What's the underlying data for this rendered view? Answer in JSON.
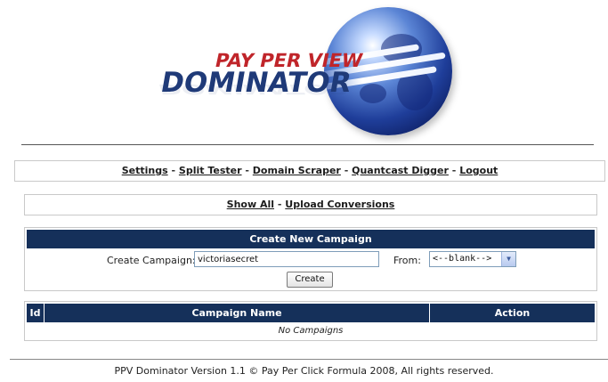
{
  "logo": {
    "line1": "PAY PER VIEW",
    "line2": "DOMINATOR"
  },
  "nav": {
    "items": [
      "Settings",
      "Split Tester",
      "Domain Scraper",
      "Quantcast Digger",
      "Logout"
    ],
    "separator": "-"
  },
  "subnav": {
    "items": [
      "Show All",
      "Upload Conversions"
    ],
    "separator": "-"
  },
  "create_panel": {
    "title": "Create New Campaign",
    "create_label": "Create Campaign:",
    "campaign_value": "victoriasecret",
    "from_label": "From:",
    "from_selected": "<--blank-->",
    "button_label": "Create"
  },
  "campaign_table": {
    "columns": [
      "Id",
      "Campaign Name",
      "Action"
    ],
    "empty_text": "No Campaigns"
  },
  "footer": {
    "text": "PPV Dominator Version 1.1 © Pay Per Click Formula 2008, All rights reserved."
  },
  "colors": {
    "header_bar": "#15305a",
    "logo_red": "#c0252a",
    "logo_blue": "#1f3a78"
  }
}
